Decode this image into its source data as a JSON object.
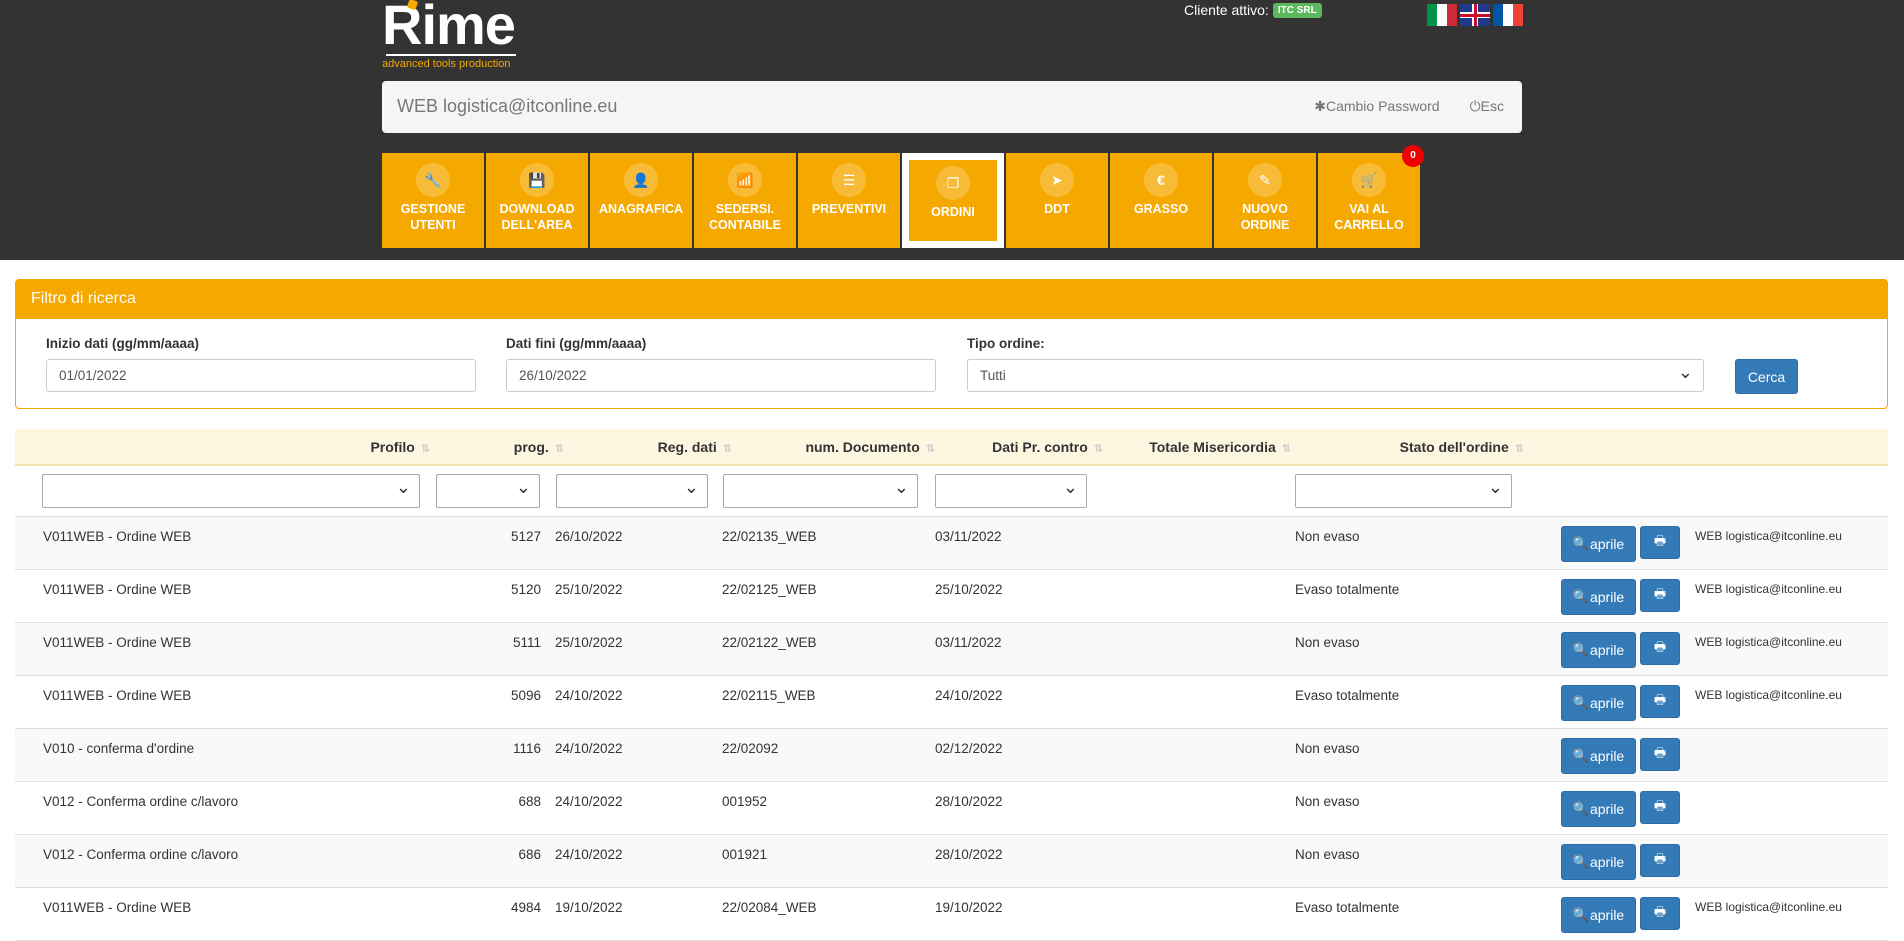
{
  "brand": {
    "name": "Rime",
    "tagline": "advanced tools production"
  },
  "header": {
    "cliente_label": "Cliente attivo:",
    "cliente_badge": "ITC SRL",
    "user": "WEB logistica@itconline.eu",
    "cambio_password": "✱Cambio Password",
    "esc": "⏻Esc"
  },
  "nav": [
    {
      "l1": "GESTIONE",
      "l2": "UTENTI",
      "icon": "wrench-icon",
      "glyph": "🔧"
    },
    {
      "l1": "DOWNLOAD",
      "l2": "DELL'AREA",
      "icon": "save-icon",
      "glyph": "💾"
    },
    {
      "l1": "ANAGRAFICA",
      "l2": "",
      "icon": "user-icon",
      "glyph": "👤"
    },
    {
      "l1": "SEDERSI.",
      "l2": "CONTABILE",
      "icon": "signal-icon",
      "glyph": "📶"
    },
    {
      "l1": "PREVENTIVI",
      "l2": "",
      "icon": "list-icon",
      "glyph": "☰"
    },
    {
      "l1": "ORDINI",
      "l2": "",
      "icon": "copy-icon",
      "glyph": "❐"
    },
    {
      "l1": "DDT",
      "l2": "",
      "icon": "send-icon",
      "glyph": "➤"
    },
    {
      "l1": "GRASSO",
      "l2": "",
      "icon": "euro-icon",
      "glyph": "€"
    },
    {
      "l1": "NUOVO",
      "l2": "ORDINE",
      "icon": "edit-icon",
      "glyph": "✎"
    },
    {
      "l1": "VAI AL",
      "l2": "CARRELLO",
      "icon": "cart-icon",
      "glyph": "🛒"
    }
  ],
  "cart_count": "0",
  "filter": {
    "title": "Filtro di ricerca",
    "start_label": "Inizio dati (gg/mm/aaaa)",
    "start_value": "01/01/2022",
    "end_label": "Dati fini (gg/mm/aaaa)",
    "end_value": "26/10/2022",
    "type_label": "Tipo ordine:",
    "type_value": "Tutti",
    "search_button": "Cerca"
  },
  "columns": {
    "profilo": "Profilo",
    "prog": "prog.",
    "reg": "Reg. dati",
    "num": "num. Documento",
    "dati_pr": "Dati Pr. contro",
    "totale": "Totale Misericordia",
    "stato": "Stato dell'ordine"
  },
  "open_label": "aprile",
  "rows": [
    {
      "profilo": "V011WEB - Ordine WEB",
      "prog": "5127",
      "reg": "26/10/2022",
      "num": "22/02135_WEB",
      "dati_pr": "03/11/2022",
      "stato": "Non evaso",
      "utente": "WEB logistica@itconline.eu"
    },
    {
      "profilo": "V011WEB - Ordine WEB",
      "prog": "5120",
      "reg": "25/10/2022",
      "num": "22/02125_WEB",
      "dati_pr": "25/10/2022",
      "stato": "Evaso totalmente",
      "utente": "WEB logistica@itconline.eu"
    },
    {
      "profilo": "V011WEB - Ordine WEB",
      "prog": "5111",
      "reg": "25/10/2022",
      "num": "22/02122_WEB",
      "dati_pr": "03/11/2022",
      "stato": "Non evaso",
      "utente": "WEB logistica@itconline.eu"
    },
    {
      "profilo": "V011WEB - Ordine WEB",
      "prog": "5096",
      "reg": "24/10/2022",
      "num": "22/02115_WEB",
      "dati_pr": "24/10/2022",
      "stato": "Evaso totalmente",
      "utente": "WEB logistica@itconline.eu"
    },
    {
      "profilo": "V010 - conferma d'ordine",
      "prog": "1116",
      "reg": "24/10/2022",
      "num": "22/02092",
      "dati_pr": "02/12/2022",
      "stato": "Non evaso",
      "utente": ""
    },
    {
      "profilo": "V012 - Conferma ordine c/lavoro",
      "prog": "688",
      "reg": "24/10/2022",
      "num": "001952",
      "dati_pr": "28/10/2022",
      "stato": "Non evaso",
      "utente": ""
    },
    {
      "profilo": "V012 - Conferma ordine c/lavoro",
      "prog": "686",
      "reg": "24/10/2022",
      "num": "001921",
      "dati_pr": "28/10/2022",
      "stato": "Non evaso",
      "utente": ""
    },
    {
      "profilo": "V011WEB - Ordine WEB",
      "prog": "4984",
      "reg": "19/10/2022",
      "num": "22/02084_WEB",
      "dati_pr": "19/10/2022",
      "stato": "Evaso totalmente",
      "utente": "WEB logistica@itconline.eu"
    }
  ]
}
